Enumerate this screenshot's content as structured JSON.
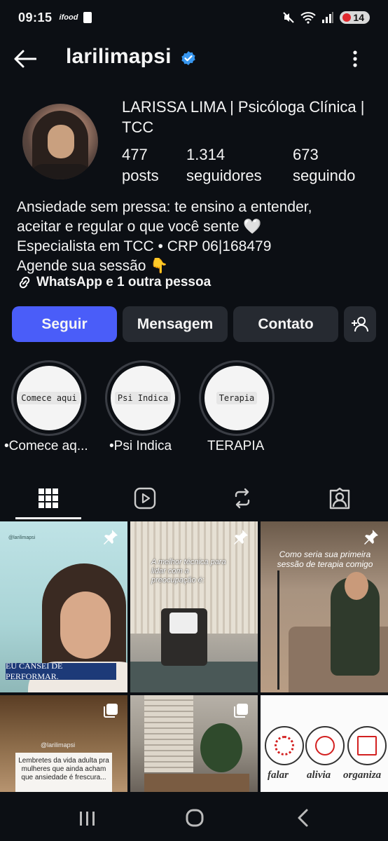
{
  "status_bar": {
    "time": "09:15",
    "carrier_badge": "ifood",
    "battery": "14"
  },
  "header": {
    "username": "larilimapsi"
  },
  "profile": {
    "display_name": "LARISSA LIMA | Psicóloga Clínica | TCC",
    "stats": [
      {
        "value": "477",
        "label": "posts"
      },
      {
        "value": "1.314",
        "label": "seguidores"
      },
      {
        "value": "673",
        "label": "seguindo"
      }
    ],
    "bio": [
      "Ansiedade sem pressa: te ensino a entender,",
      "aceitar e regular o que você sente 🤍",
      "Especialista em TCC • CRP 06|168479",
      "Agende sua sessão 👇"
    ],
    "links": "WhatsApp e 1 outra pessoa"
  },
  "actions": {
    "follow": "Seguir",
    "message": "Mensagem",
    "contact": "Contato"
  },
  "highlights": [
    {
      "cover_text": "Comece aqui",
      "caption": "•Comece aq..."
    },
    {
      "cover_text": "Psi Indica",
      "caption": "•Psi Indica"
    },
    {
      "cover_text": "Terapia",
      "caption": "TERAPIA"
    }
  ],
  "tabs": [
    "grid-icon",
    "reels-icon",
    "reposts-icon",
    "tagged-icon"
  ],
  "posts": {
    "p1": {
      "handle": "@larilimapsi",
      "caption": "EU CANSEI DE PERFORMAR."
    },
    "p2": {
      "text": "A melhor técnica para lidar com a preocupação é:"
    },
    "p3": {
      "text": "Como seria sua primeira sessão de terapia comigo"
    },
    "p4": {
      "handle": "@larilimapsi",
      "text": "Lembretes da vida adulta pra mulheres que ainda acham que ansiedade é frescura..."
    },
    "p6": {
      "words": [
        "falar",
        "alivia",
        "organiza"
      ]
    }
  },
  "colors": {
    "background": "#0c0f14",
    "primary_button": "#4a5df9",
    "secondary_button": "#262a31",
    "verified": "#3897f0"
  }
}
